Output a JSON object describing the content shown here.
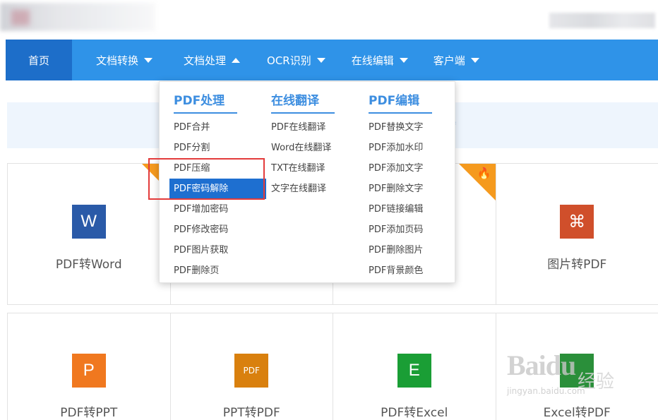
{
  "nav": {
    "items": [
      {
        "label": "首页"
      },
      {
        "label": "文档转换"
      },
      {
        "label": "文档处理"
      },
      {
        "label": "OCR识别"
      },
      {
        "label": "在线编辑"
      },
      {
        "label": "客户端"
      }
    ]
  },
  "dropdown": {
    "columns": [
      {
        "title": "PDF处理",
        "items": [
          "PDF合并",
          "PDF分割",
          "PDF压缩",
          "PDF密码解除",
          "PDF增加密码",
          "PDF修改密码",
          "PDF图片获取",
          "PDF删除页"
        ]
      },
      {
        "title": "在线翻译",
        "items": [
          "PDF在线翻译",
          "Word在线翻译",
          "TXT在线翻译",
          "文字在线翻译"
        ]
      },
      {
        "title": "PDF编辑",
        "items": [
          "PDF替换文字",
          "PDF添加水印",
          "PDF添加文字",
          "PDF删除文字",
          "PDF链接编辑",
          "PDF添加页码",
          "PDF删除图片",
          "PDF背景颜色"
        ]
      }
    ],
    "active_item": "PDF密码解除"
  },
  "tools": {
    "row1": [
      {
        "label": "PDF转Word",
        "glyph": "W",
        "color": "#2a5aa8",
        "icon": "word-icon"
      },
      {
        "label": "",
        "glyph": "",
        "color": "",
        "icon": ""
      },
      {
        "label": "",
        "glyph": "",
        "color": "",
        "icon": ""
      },
      {
        "label": "图片转PDF",
        "glyph": "⌘",
        "color": "#d04f2b",
        "icon": "pdf-icon"
      }
    ],
    "row2": [
      {
        "label": "PDF转PPT",
        "glyph": "P",
        "color": "#f0781f",
        "icon": "ppt-icon"
      },
      {
        "label": "PPT转PDF",
        "glyph": "PDF",
        "color": "#d9800e",
        "icon": "ppt-pdf-icon"
      },
      {
        "label": "PDF转Excel",
        "glyph": "E",
        "color": "#1a9e35",
        "icon": "excel-icon"
      },
      {
        "label": "Excel转PDF",
        "glyph": "",
        "color": "#2a8f3a",
        "icon": "excel-pdf-icon"
      }
    ]
  },
  "notice": {
    "fragment": "≈"
  },
  "watermark": {
    "brand": "Baidu",
    "cn": "经验",
    "url": "jingyan.baidu.com"
  },
  "colors": {
    "nav": "#2f93e8",
    "nav_active": "#1d6ec9",
    "menu_accent": "#3d8ee0",
    "highlight": "#e33b3b"
  }
}
